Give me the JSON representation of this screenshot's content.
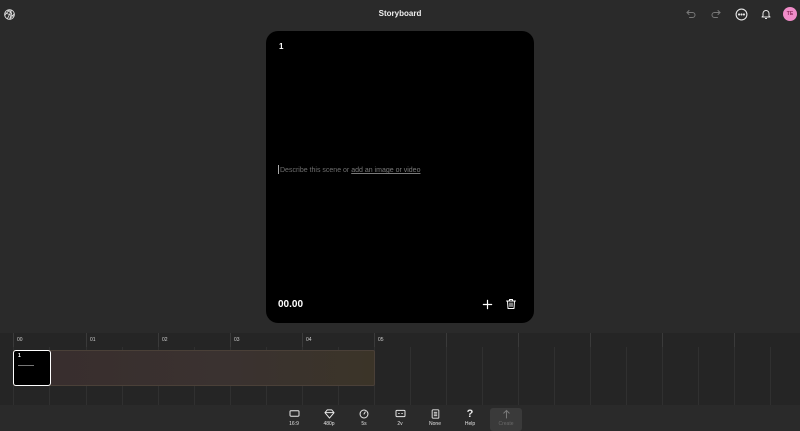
{
  "header": {
    "title": "Storyboard",
    "logo_icon": "openai-logo-icon",
    "undo_icon": "undo-icon",
    "redo_icon": "redo-icon",
    "more_icon": "more-icon",
    "bell_icon": "bell-icon",
    "avatar_initials": "TE",
    "avatar_color": "#f08cc8"
  },
  "scene": {
    "number": "1",
    "prompt_text": "Describe this scene or ",
    "prompt_link": "add an image or video",
    "time": "00.00",
    "add_icon": "plus-icon",
    "delete_icon": "trash-icon"
  },
  "timeline": {
    "ticks": [
      "00",
      "01",
      "02",
      "03",
      "04",
      "05"
    ],
    "clip_number": "1"
  },
  "toolbar": {
    "items": [
      {
        "label": "16:9",
        "icon": "aspect-ratio-icon"
      },
      {
        "label": "480p",
        "icon": "diamond-icon"
      },
      {
        "label": "5s",
        "icon": "clock-icon"
      },
      {
        "label": "2v",
        "icon": "variations-icon"
      },
      {
        "label": "None",
        "icon": "preset-icon"
      },
      {
        "label": "Help",
        "icon": "question-icon"
      },
      {
        "label": "Create",
        "icon": "arrow-up-icon"
      }
    ]
  }
}
